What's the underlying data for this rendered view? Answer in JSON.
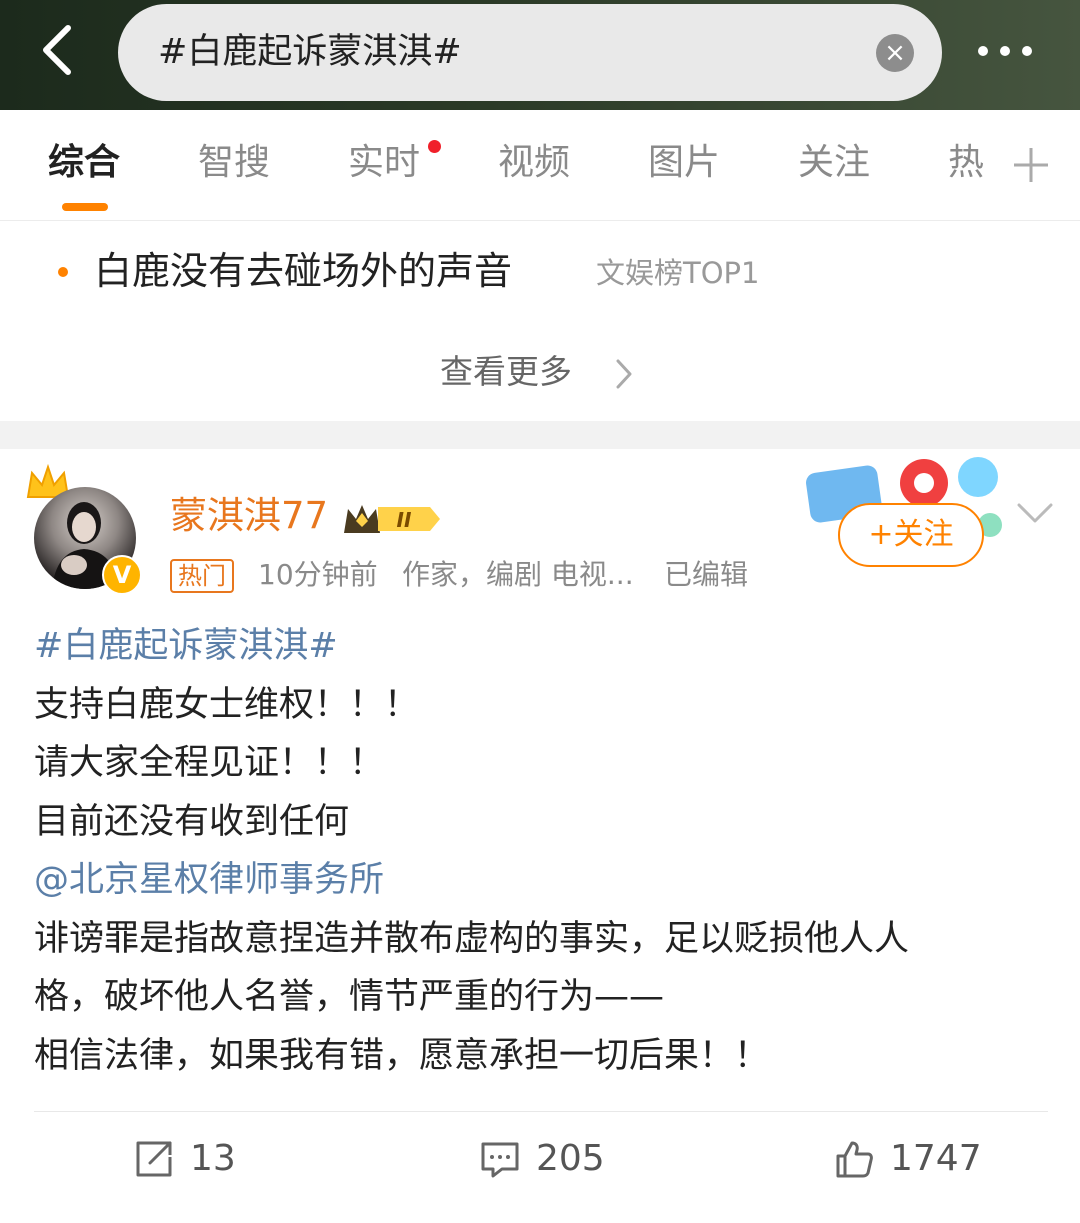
{
  "search": {
    "query": "#白鹿起诉蒙淇淇#"
  },
  "tabs": [
    {
      "label": "综合",
      "active": true
    },
    {
      "label": "智搜"
    },
    {
      "label": "实时",
      "has_red_dot": true
    },
    {
      "label": "视频"
    },
    {
      "label": "图片"
    },
    {
      "label": "关注"
    },
    {
      "label": "热"
    }
  ],
  "hot": {
    "title": "白鹿没有去碰场外的声音",
    "tag": "文娱榜TOP1",
    "see_more": "查看更多"
  },
  "post": {
    "username": "蒙淇淇77",
    "vip_level": "II",
    "hot_label": "热门",
    "time": "10分钟前",
    "desc": "作家，编剧 电视...",
    "edited": "已编辑",
    "follow_label": "+关注",
    "lines": [
      "#白鹿起诉蒙淇淇#",
      "支持白鹿女士维权！！！",
      "请大家全程见证！！！",
      "目前还没有收到任何",
      "@北京星权律师事务所",
      "诽谤罪是指故意捏造并散布虚构的事实，足以贬损他人人",
      "格，破坏他人名誉，情节严重的行为——",
      "相信法律，如果我有错，愿意承担一切后果！！"
    ],
    "actions": {
      "reposts": "13",
      "comments": "205",
      "likes": "1747"
    }
  },
  "colors": {
    "accent": "#ff8200",
    "username": "#e8771e",
    "link": "#5b7fa8",
    "red_dot": "#f0202a"
  },
  "icons": [
    "back-arrow-icon",
    "clear-icon",
    "more-dots-icon",
    "plus-icon",
    "chevron-right-icon",
    "crown-icon",
    "verified-badge-icon",
    "vip-crown-icon",
    "chevron-down-icon",
    "repost-icon",
    "comment-icon",
    "like-icon"
  ]
}
